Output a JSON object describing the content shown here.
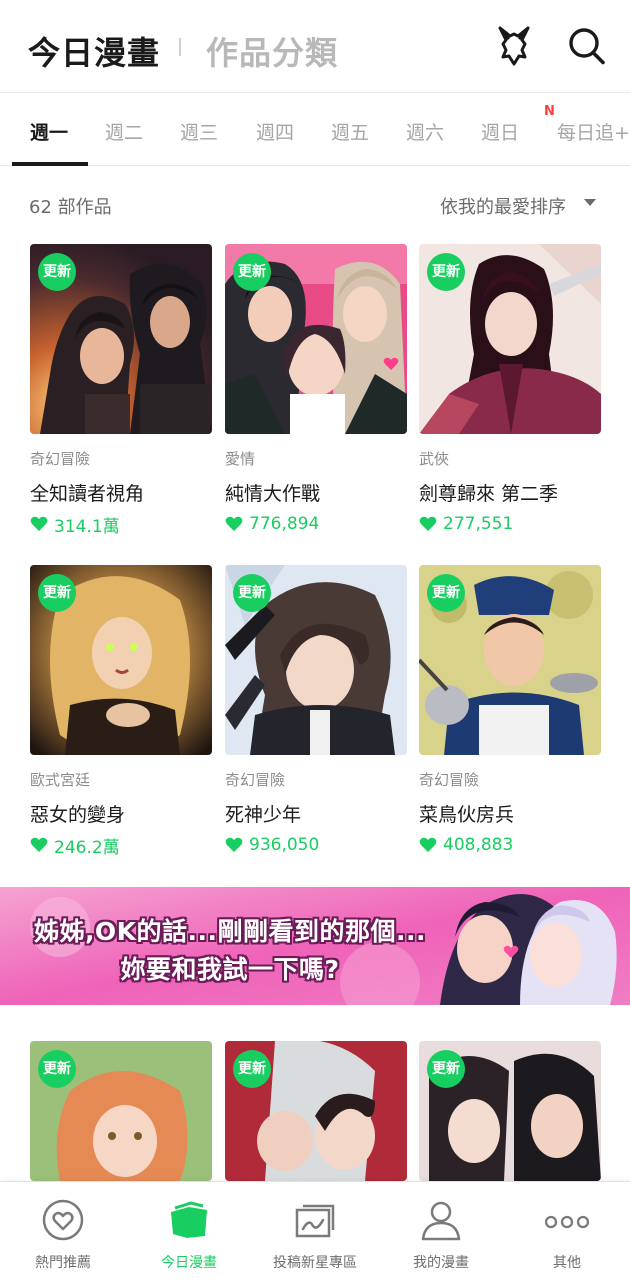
{
  "header": {
    "title": "今日漫畫",
    "secondary_title": "作品分類",
    "icons": [
      "category-animal-icon",
      "search-icon"
    ]
  },
  "tabs": [
    {
      "label": "週一",
      "active": true
    },
    {
      "label": "週二"
    },
    {
      "label": "週三"
    },
    {
      "label": "週四"
    },
    {
      "label": "週五"
    },
    {
      "label": "週六"
    },
    {
      "label": "週日"
    },
    {
      "label": "每日追+",
      "badge": "N"
    }
  ],
  "list": {
    "count_text": "62 部作品",
    "sort_label": "依我的最愛排序"
  },
  "badge_label": "更新",
  "cards": [
    {
      "genre": "奇幻冒險",
      "title": "全知讀者視角",
      "likes": "314.1萬"
    },
    {
      "genre": "愛情",
      "title": "純情大作戰",
      "likes": "776,894"
    },
    {
      "genre": "武俠",
      "title": "劍尊歸來 第二季",
      "likes": "277,551"
    },
    {
      "genre": "歐式宮廷",
      "title": "惡女的變身",
      "likes": "246.2萬"
    },
    {
      "genre": "奇幻冒險",
      "title": "死神少年",
      "likes": "936,050"
    },
    {
      "genre": "奇幻冒險",
      "title": "菜鳥伙房兵",
      "likes": "408,883"
    }
  ],
  "banner": {
    "line1": "姊姊,OK的話...剛剛看到的那個...",
    "line2": "妳要和我試一下嗎?"
  },
  "bottom_nav": [
    {
      "label": "熱門推薦",
      "icon": "heart-circle-icon"
    },
    {
      "label": "今日漫畫",
      "icon": "comic-book-icon",
      "active": true
    },
    {
      "label": "投稿新星專區",
      "icon": "canvas-icon"
    },
    {
      "label": "我的漫畫",
      "icon": "person-icon"
    },
    {
      "label": "其他",
      "icon": "more-dots-icon"
    }
  ],
  "colors": {
    "accent_green": "#19ce60",
    "new_badge_red": "#ff3b3b",
    "banner_pink": "#ef63b8"
  }
}
